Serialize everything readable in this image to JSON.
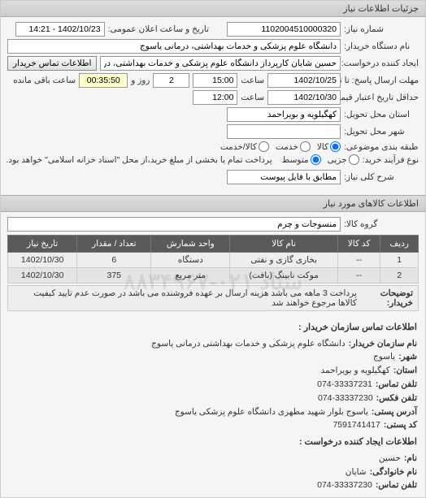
{
  "header": {
    "title": "جزئیات اطلاعات نیاز"
  },
  "form": {
    "requestNoLabel": "شماره نیاز:",
    "requestNo": "1102004510000320",
    "publicDateLabel": "تاریخ و ساعت اعلان عمومی:",
    "publicDate": "1402/10/23 - 14:21",
    "buyerNameLabel": "نام دستگاه خریدار:",
    "buyerName": "دانشگاه علوم پزشکی و خدمات بهداشتی، درمانی یاسوج",
    "requesterLabel": "ایجاد کننده درخواست:",
    "requester": "حسین شایان کارپرداز دانشگاه علوم پزشکی و خدمات بهداشتی، درمانی یاسوج",
    "contactBtn": "اطلاعات تماس خریدار",
    "deadlineSendLabel": "مهلت ارسال پاسخ: تا تاریخ:",
    "deadlineSendDate": "1402/10/25",
    "deadlineSendTimeLabel": "ساعت",
    "deadlineSendTime": "15:00",
    "remainingDaysVal": "2",
    "remainingDaysLabel": "روز و",
    "remainingTime": "00:35:50",
    "remainingTimeLabel": "ساعت باقی مانده",
    "validityLabel": "حداقل تاریخ اعتبار قیمت: تا تاریخ:",
    "validityDate": "1402/10/30",
    "validityTimeLabel": "ساعت",
    "validityTime": "12:00",
    "deliveryProvinceLabel": "استان محل تحویل:",
    "deliveryProvince": "کهگیلویه و بویراحمد",
    "deliveryCityLabel": "شهر محل تحویل:",
    "deliveryCity": "",
    "subjectClassLabel": "طبقه بندی موضوعی:",
    "radioGoods": "کالا",
    "radioService": "خدمت",
    "radioBoth": "کالا/خدمت",
    "processTypeLabel": "نوع فرآیند خرید:",
    "radioPartial": "جزیی",
    "radioMedium": "متوسط",
    "processNote": "پرداخت تمام یا بخشی از مبلغ خرید،از محل \"اسناد خزانه اسلامی\" خواهد بود.",
    "generalDescLabel": "شرح کلی نیاز:",
    "generalDesc": "مطابق با فایل پیوست"
  },
  "itemsSection": {
    "title": "اطلاعات کالاهای مورد نیاز",
    "groupLabel": "گروه کالا:",
    "group": "منسوجات و چرم"
  },
  "table": {
    "headers": [
      "ردیف",
      "کد کالا",
      "نام کالا",
      "واحد شمارش",
      "تعداد / مقدار",
      "تاریخ نیاز"
    ],
    "rows": [
      {
        "idx": "1",
        "code": "--",
        "name": "بخاری گازی و نفتی",
        "unit": "دستگاه",
        "qty": "6",
        "date": "1402/10/30"
      },
      {
        "idx": "2",
        "code": "--",
        "name": "موکت نابینگ (بافت)",
        "unit": "متر مربع",
        "qty": "375",
        "date": "1402/10/30"
      }
    ]
  },
  "buyerNote": {
    "label": "توضیحات خریدار:",
    "text": "پرداخت 3 ماهه می باشد هزینه ارسال بر عهده فروشنده می باشد در صورت عدم تایید کیفیت کالاها مرجوع خواهند شد"
  },
  "contact": {
    "sectionTitle1": "اطلاعات تماس سازمان خریدار :",
    "orgNameLabel": "نام سازمان خریدار:",
    "orgName": "دانشگاه علوم پزشکی و خدمات بهداشتی درمانی یاسوج",
    "cityLabel": "شهر:",
    "city": "یاسوج",
    "provinceLabel": "استان:",
    "province": "کهگیلویه و بویراحمد",
    "phoneLabel": "تلفن تماس:",
    "phone": "074-33337231",
    "faxLabel": "تلفن فکس:",
    "fax": "074-33337230",
    "postAddrLabel": "آدرس پستی:",
    "postAddr": "یاسوج بلوار شهید مطهری دانشگاه علوم پزشکی یاسوج",
    "postCodeLabel": "کد پستی:",
    "postCode": "7591741417",
    "sectionTitle2": "اطلاعات ایجاد کننده درخواست :",
    "fnameLabel": "نام:",
    "fname": "حسین",
    "lnameLabel": "نام خانوادگی:",
    "lname": "شایان",
    "reqPhoneLabel": "تلفن تماس:",
    "reqPhone": "074-33337230"
  },
  "watermark": "ستاد ۰۲۱-۸۸۳۴۹۶۷"
}
